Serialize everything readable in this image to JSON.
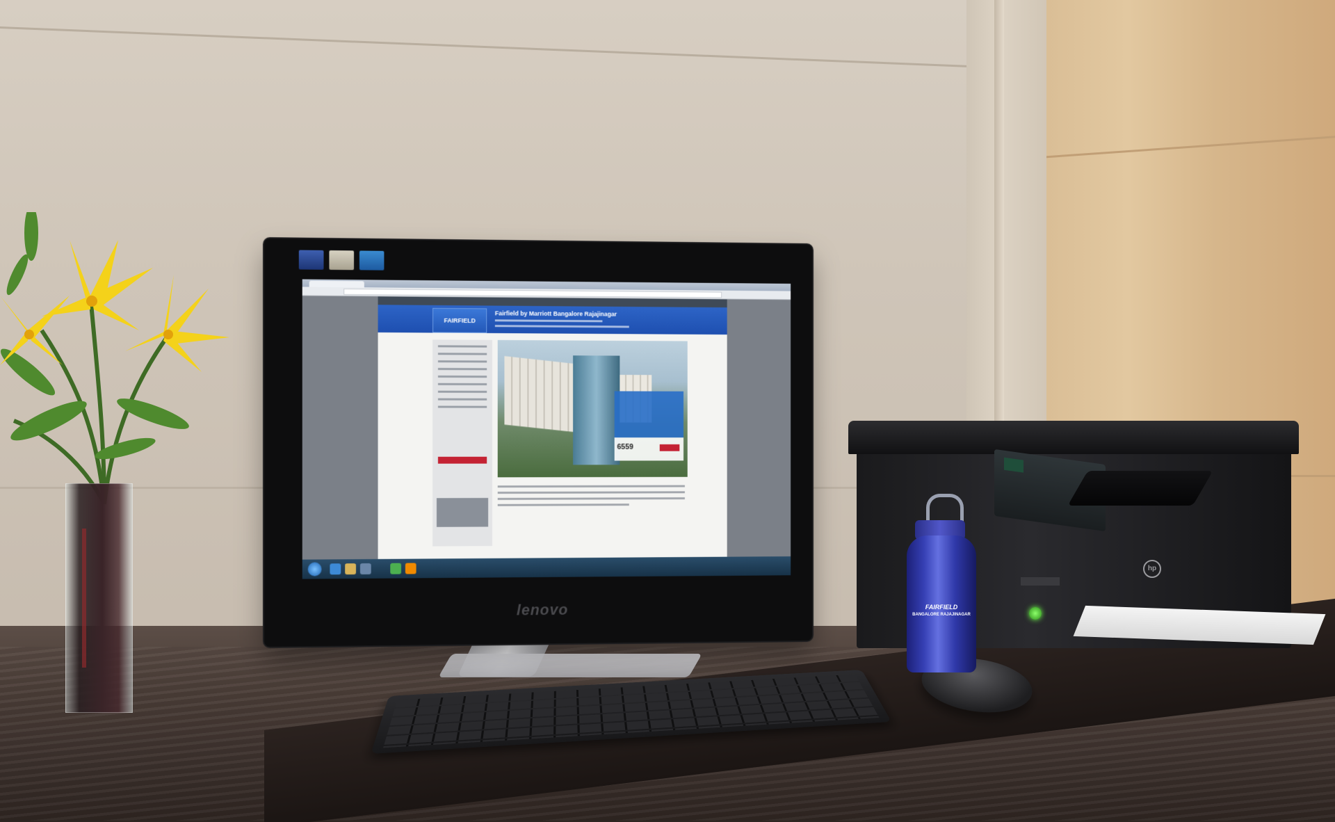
{
  "screen": {
    "browser_tab": "",
    "site_title": "Fairfield by Marriott Bangalore Rajajinagar",
    "logo_text": "FAIRFIELD",
    "price": "6559"
  },
  "monitor": {
    "brand": "lenovo"
  },
  "bottle": {
    "brand": "FAIRFIELD",
    "sub": "BANGALORE RAJAJINAGAR"
  },
  "printer": {
    "brand": "hp"
  },
  "colors": {
    "site_blue": "#1e4fb0",
    "lily_yellow": "#f4d21a",
    "bottle_blue": "#3640b5",
    "desk": "#3b302c"
  }
}
